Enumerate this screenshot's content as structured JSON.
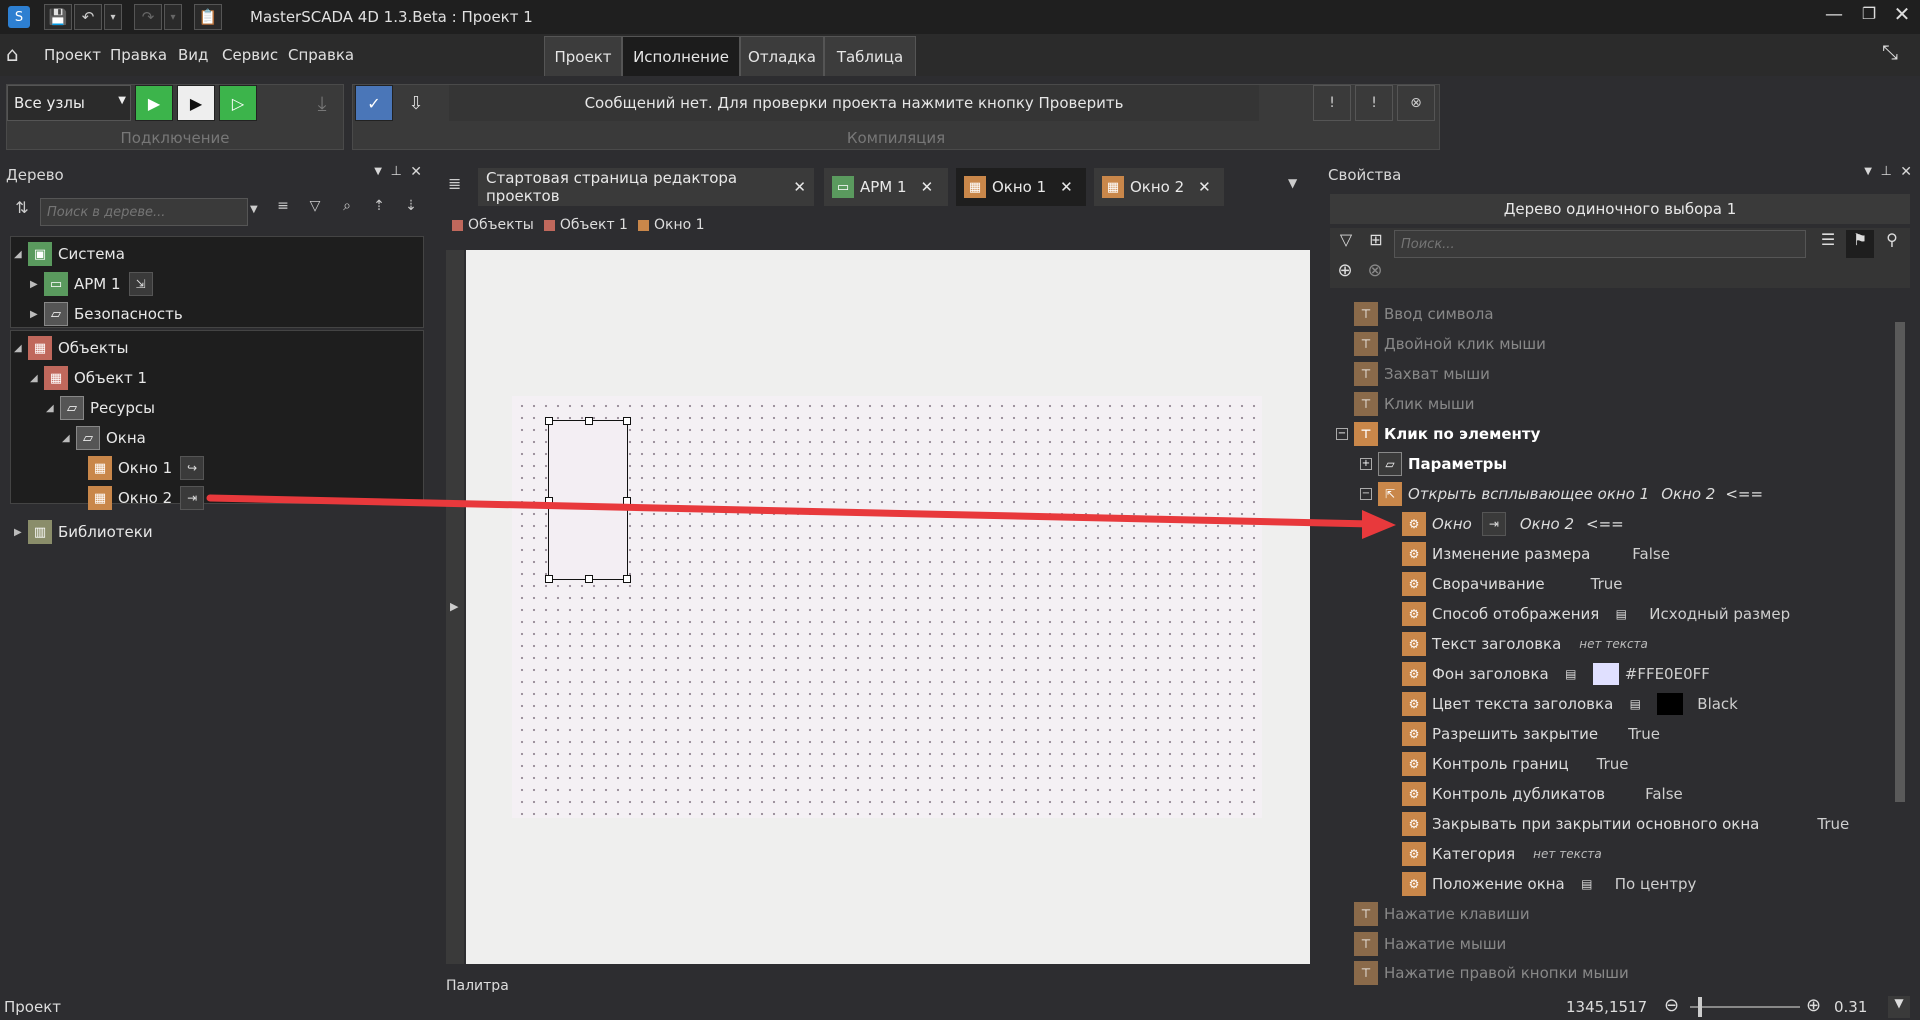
{
  "window": {
    "title": "MasterSCADA 4D 1.3.Beta : Проект 1"
  },
  "menu": [
    "Проект",
    "Правка",
    "Вид",
    "Сервис",
    "Справка"
  ],
  "ribbon_tabs": [
    "Проект",
    "Исполнение",
    "Отладка",
    "Таблица"
  ],
  "ribbon": {
    "node_select": "Все узлы",
    "group_connection": "Подключение",
    "group_compile": "Компиляция",
    "message": "Сообщений нет. Для проверки проекта нажмите кнопку Проверить"
  },
  "tree_panel": {
    "title": "Дерево",
    "search_placeholder": "Поиск в дереве...",
    "items": [
      {
        "label": "Система"
      },
      {
        "label": "АРМ 1"
      },
      {
        "label": "Безопасность"
      },
      {
        "label": "Объекты"
      },
      {
        "label": "Объект 1"
      },
      {
        "label": "Ресурсы"
      },
      {
        "label": "Окна"
      },
      {
        "label": "Окно 1"
      },
      {
        "label": "Окно 2"
      },
      {
        "label": "Библиотеки"
      }
    ]
  },
  "doc_tabs": [
    "Стартовая страница редактора проектов",
    "АРМ 1",
    "Окно 1",
    "Окно 2"
  ],
  "breadcrumb": [
    "Объекты",
    "Объект 1",
    "Окно 1"
  ],
  "palette_title": "Палитра",
  "props_panel": {
    "title": "Свойства",
    "object_title": "Дерево одиночного выбора 1",
    "search_placeholder": "Поиск...",
    "events_before": [
      "Ввод символа",
      "Двойной клик мыши",
      "Захват мыши",
      "Клик мыши"
    ],
    "click_event": "Клик по элементу",
    "params": "Параметры",
    "action": {
      "label": "Открыть всплывающее окно 1",
      "value": "Окно 2",
      "arrow": "<=="
    },
    "window_row": {
      "label": "Окно",
      "value": "Окно 2",
      "arrow": "<=="
    },
    "props": [
      {
        "label": "Изменение размера",
        "value": "False"
      },
      {
        "label": "Сворачивание",
        "value": "True"
      },
      {
        "label": "Способ отображения",
        "value": "Исходный размер"
      },
      {
        "label": "Текст заголовка",
        "value": "нет текста"
      },
      {
        "label": "Фон заголовка",
        "value": "#FFE0E0FF"
      },
      {
        "label": "Цвет текста заголовка",
        "value": "Black"
      },
      {
        "label": "Разрешить закрытие",
        "value": "True"
      },
      {
        "label": "Контроль границ",
        "value": "True"
      },
      {
        "label": "Контроль дубликатов",
        "value": "False"
      },
      {
        "label": "Закрывать при закрытии основного окна",
        "value": "True"
      },
      {
        "label": "Категория",
        "value": "нет текста"
      },
      {
        "label": "Положение окна",
        "value": "По центру"
      }
    ],
    "events_after": [
      "Нажатие клавиши",
      "Нажатие мыши",
      "Нажатие правой кнопки мыши"
    ]
  },
  "status": {
    "left": "Проект",
    "coords": "1345,1517",
    "zoom": "0.31"
  },
  "colors": {
    "accent_green": "#5a9a5e",
    "accent_orange": "#c9874a",
    "accent_red": "#c0685c",
    "title_bg_swatch": "#e0e0ff",
    "annotation_arrow": "#e8393c"
  }
}
